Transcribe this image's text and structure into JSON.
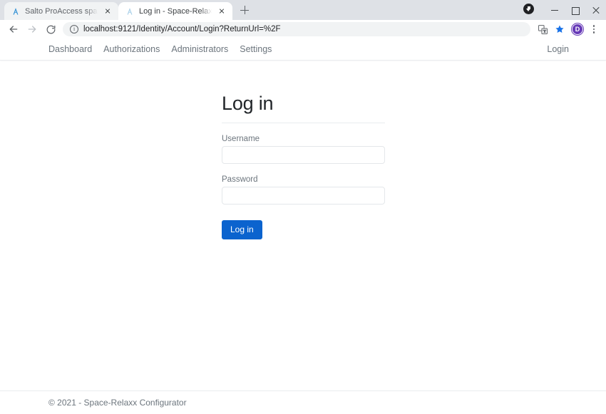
{
  "browser": {
    "tabs": [
      {
        "title": "Salto ProAccess space",
        "active": false,
        "favicon": "salto-logo-icon"
      },
      {
        "title": "Log in - Space-Relaxx Configurat",
        "active": true,
        "favicon": "salto-logo-icon"
      }
    ],
    "new_tab_label": "+",
    "window_controls": {
      "minimize": "—",
      "maximize": "□",
      "close": "✕"
    },
    "download_indicator": "download-complete-icon",
    "navigation": {
      "back": "←",
      "forward": "→",
      "reload": "↻"
    },
    "omnibox": {
      "url": "localhost:9121/Identity/Account/Login?ReturnUrl=%2F",
      "site_info_icon": "info-circle-icon"
    },
    "toolbar_icons": {
      "translate": "translate-icon",
      "bookmark": "star-icon",
      "bookmark_color": "#1a73e8",
      "profile_initial": "D",
      "profile_color": "#673ab7",
      "menu": "kebab-menu-icon"
    }
  },
  "site": {
    "nav": {
      "links": [
        {
          "label": "Dashboard"
        },
        {
          "label": "Authorizations"
        },
        {
          "label": "Administrators"
        },
        {
          "label": "Settings"
        }
      ],
      "login_label": "Login"
    },
    "login_form": {
      "heading": "Log in",
      "username": {
        "label": "Username",
        "value": "",
        "placeholder": ""
      },
      "password": {
        "label": "Password",
        "value": "",
        "placeholder": ""
      },
      "submit_label": "Log in",
      "submit_color": "#0b63ce"
    },
    "footer": {
      "text": "© 2021 - Space-Relaxx Configurator"
    }
  }
}
